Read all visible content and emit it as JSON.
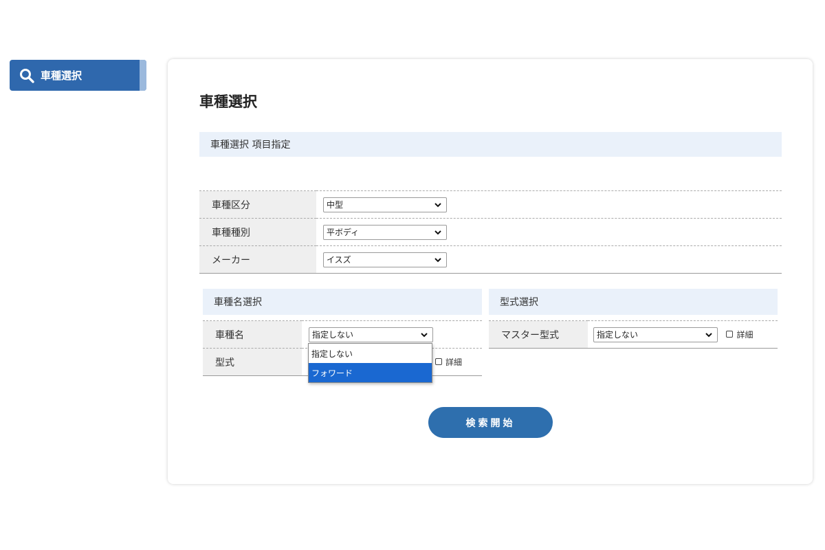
{
  "sidebar": {
    "item_label": "車種選択",
    "icon": "search-icon"
  },
  "page": {
    "title": "車種選択"
  },
  "item_section": {
    "heading": "車種選択 項目指定",
    "rows": [
      {
        "label": "車種区分",
        "value": "中型"
      },
      {
        "label": "車種種別",
        "value": "平ボディ"
      },
      {
        "label": "メーカー",
        "value": "イスズ"
      }
    ]
  },
  "name_section": {
    "heading": "車種名選択",
    "name_label": "車種名",
    "name_value": "指定しない",
    "model_label": "型式",
    "detail_label": "詳細",
    "dropdown_options": [
      "指定しない",
      "フォワード"
    ],
    "dropdown_highlighted": "フォワード"
  },
  "model_section": {
    "heading": "型式選択",
    "master_label": "マスター型式",
    "master_value": "指定しない",
    "detail_label": "詳細"
  },
  "actions": {
    "search_label": "検索開始"
  },
  "colors": {
    "primary": "#2f68ad",
    "section_bg": "#eaf1fa",
    "highlight": "#1a68d1"
  }
}
